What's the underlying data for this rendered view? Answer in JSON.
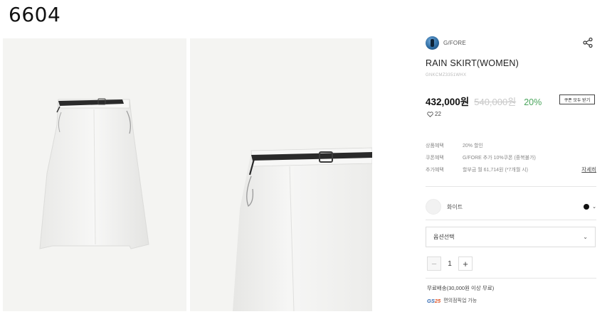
{
  "page": {
    "id": "6604"
  },
  "gallery": {
    "image1_alt": "skirt-full-view",
    "image2_alt": "skirt-waist-detail"
  },
  "brand": {
    "name": "G/FORE",
    "logo_icon": "brand-logo-icon"
  },
  "product": {
    "title": "RAIN SKIRT(WOMEN)",
    "code": "GNKCMZ3351WHX",
    "price": "432,000원",
    "original_price": "540,000원",
    "discount": "20%",
    "likes": "22"
  },
  "coupon_button_label": "쿠폰 모두 받기",
  "benefits": [
    {
      "label": "상품혜택",
      "value": "20% 할인"
    },
    {
      "label": "쿠폰혜택",
      "value": "G/FORE 추가 10%쿠폰 (중복불가)"
    },
    {
      "label": "추가혜택",
      "value": "할부금 월 61,714원 (*7개월 시)",
      "link": "자세히"
    }
  ],
  "color": {
    "name": "화이트",
    "dot_color": "#111111"
  },
  "option_select": {
    "placeholder": "옵션선택"
  },
  "quantity": {
    "value": "1",
    "minus": "−",
    "plus": "+"
  },
  "shipping": {
    "text": "무료배송(30,000원 이상 무료)"
  },
  "store_pickup": {
    "logo_main": "GS",
    "logo_accent": "25",
    "text": "편의점픽업 가능"
  },
  "colors": {
    "accent_green": "#4aa55c",
    "text": "#222222"
  }
}
